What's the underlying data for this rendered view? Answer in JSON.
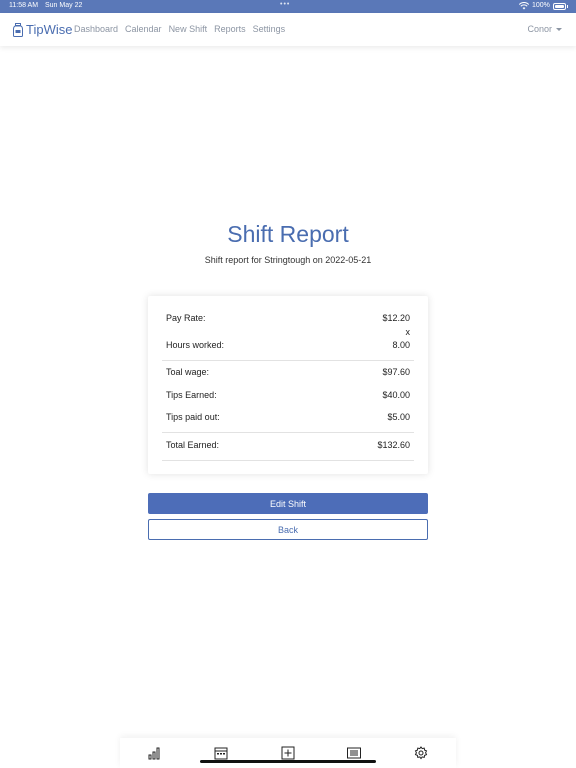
{
  "status_bar": {
    "time": "11:58 AM",
    "date": "Sun May 22",
    "battery": "100%"
  },
  "navbar": {
    "brand": "TipWise",
    "links": [
      "Dashboard",
      "Calendar",
      "New Shift",
      "Reports",
      "Settings"
    ],
    "user": "Conor"
  },
  "page": {
    "title": "Shift Report",
    "subtitle": "Shift report for Stringtough on 2022-05-21"
  },
  "report": {
    "pay_rate_label": "Pay Rate:",
    "pay_rate_value": "$12.20",
    "multiply": "x",
    "hours_label": "Hours worked:",
    "hours_value": "8.00",
    "total_wage_label": "Toal wage:",
    "total_wage_value": "$97.60",
    "tips_earned_label": "Tips Earned:",
    "tips_earned_value": "$40.00",
    "tips_paid_label": "Tips paid out:",
    "tips_paid_value": "$5.00",
    "total_earned_label": "Total Earned:",
    "total_earned_value": "$132.60"
  },
  "buttons": {
    "edit": "Edit Shift",
    "back": "Back"
  },
  "tabbar": {
    "icons": [
      "bar-chart-icon",
      "calendar-icon",
      "plus-square-icon",
      "list-icon",
      "gear-icon"
    ]
  }
}
